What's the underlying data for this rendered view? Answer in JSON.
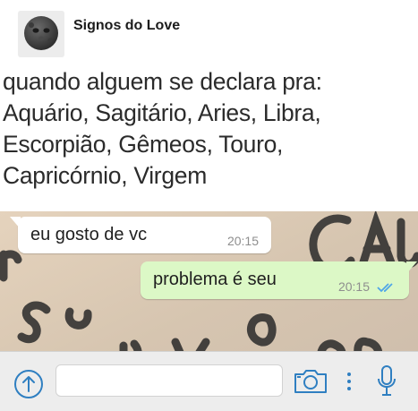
{
  "post": {
    "page_name": "Signos do Love",
    "caption_lines": [
      "quando alguem se declara pra:",
      "Aquário, Sagitário, Aries, Libra,",
      "Escorpião, Gêmeos, Touro,",
      "Capricórnio, Virgem"
    ]
  },
  "chat": {
    "incoming": {
      "text": "eu gosto de vc",
      "time": "20:15"
    },
    "outgoing": {
      "text": "problema é seu",
      "time": "20:15",
      "status": "read-double-check"
    }
  },
  "composer": {
    "placeholder": "",
    "icons": [
      "arrow-up-circle-icon",
      "camera-icon",
      "more-vertical-icon",
      "microphone-icon"
    ]
  },
  "colors": {
    "incoming_bubble": "#ffffff",
    "outgoing_bubble": "#dcf8c6",
    "read_check": "#4fa6e8",
    "icon_blue": "#2f7fc1",
    "chat_background": "#d9c9b5"
  }
}
